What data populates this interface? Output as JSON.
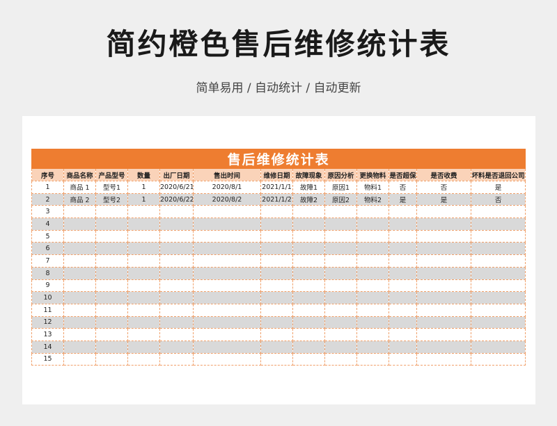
{
  "page": {
    "title": "简约橙色售后维修统计表",
    "subtitle": "简单易用 / 自动统计 / 自动更新"
  },
  "table": {
    "title": "售后维修统计表",
    "headers": [
      "序号",
      "商品名称",
      "产品型号",
      "数量",
      "出厂日期",
      "售出时间",
      "维修日期",
      "故障现象",
      "原因分析",
      "更换物料",
      "是否超保",
      "是否收费",
      "坏料是否退回公司"
    ],
    "rows": [
      [
        "1",
        "商品 1",
        "型号1",
        "1",
        "2020/6/21",
        "2020/8/1",
        "2021/1/1",
        "故障1",
        "原因1",
        "物料1",
        "否",
        "否",
        "是"
      ],
      [
        "2",
        "商品 2",
        "型号2",
        "1",
        "2020/6/22",
        "2020/8/2",
        "2021/1/2",
        "故障2",
        "原因2",
        "物料2",
        "是",
        "是",
        "否"
      ],
      [
        "3",
        "",
        "",
        "",
        "",
        "",
        "",
        "",
        "",
        "",
        "",
        "",
        ""
      ],
      [
        "4",
        "",
        "",
        "",
        "",
        "",
        "",
        "",
        "",
        "",
        "",
        "",
        ""
      ],
      [
        "5",
        "",
        "",
        "",
        "",
        "",
        "",
        "",
        "",
        "",
        "",
        "",
        ""
      ],
      [
        "6",
        "",
        "",
        "",
        "",
        "",
        "",
        "",
        "",
        "",
        "",
        "",
        ""
      ],
      [
        "7",
        "",
        "",
        "",
        "",
        "",
        "",
        "",
        "",
        "",
        "",
        "",
        ""
      ],
      [
        "8",
        "",
        "",
        "",
        "",
        "",
        "",
        "",
        "",
        "",
        "",
        "",
        ""
      ],
      [
        "9",
        "",
        "",
        "",
        "",
        "",
        "",
        "",
        "",
        "",
        "",
        "",
        ""
      ],
      [
        "10",
        "",
        "",
        "",
        "",
        "",
        "",
        "",
        "",
        "",
        "",
        "",
        ""
      ],
      [
        "11",
        "",
        "",
        "",
        "",
        "",
        "",
        "",
        "",
        "",
        "",
        "",
        ""
      ],
      [
        "12",
        "",
        "",
        "",
        "",
        "",
        "",
        "",
        "",
        "",
        "",
        "",
        ""
      ],
      [
        "13",
        "",
        "",
        "",
        "",
        "",
        "",
        "",
        "",
        "",
        "",
        "",
        ""
      ],
      [
        "14",
        "",
        "",
        "",
        "",
        "",
        "",
        "",
        "",
        "",
        "",
        "",
        ""
      ],
      [
        "15",
        "",
        "",
        "",
        "",
        "",
        "",
        "",
        "",
        "",
        "",
        "",
        ""
      ]
    ]
  }
}
